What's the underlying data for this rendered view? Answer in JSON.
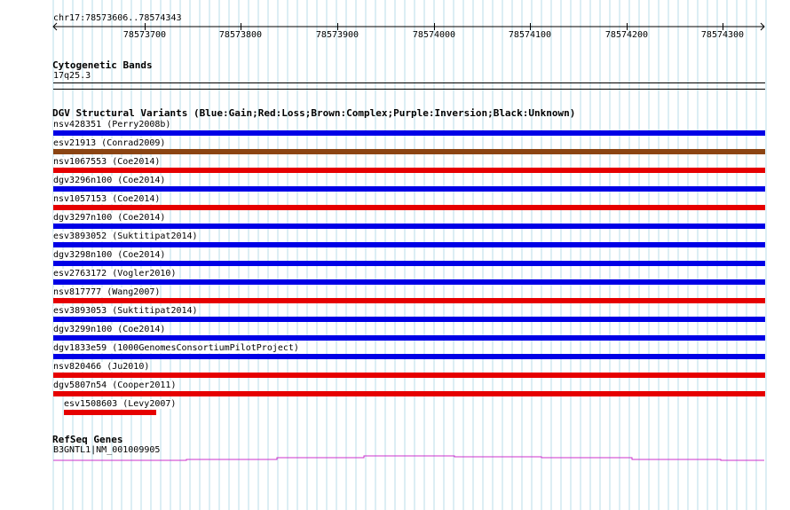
{
  "region": "chr17:78573606..78574343",
  "ruler": {
    "ticks": [
      "78573700",
      "78573800",
      "78573900",
      "78574000",
      "78574100",
      "78574200",
      "78574300"
    ]
  },
  "cytoband": {
    "title": "Cytogenetic Bands",
    "band": "17q25.3"
  },
  "dgv": {
    "title": "DGV Structural Variants (Blue:Gain;Red:Loss;Brown:Complex;Purple:Inversion;Black:Unknown)",
    "colors": {
      "gain": "#0000e6",
      "loss": "#e60000",
      "complex": "#8b4513"
    },
    "variants": [
      {
        "label": "nsv428351 (Perry2008b)",
        "type": "gain"
      },
      {
        "label": "esv21913 (Conrad2009)",
        "type": "complex"
      },
      {
        "label": "nsv1067553 (Coe2014)",
        "type": "loss"
      },
      {
        "label": "dgv3296n100 (Coe2014)",
        "type": "gain"
      },
      {
        "label": "nsv1057153 (Coe2014)",
        "type": "loss"
      },
      {
        "label": "dgv3297n100 (Coe2014)",
        "type": "gain"
      },
      {
        "label": "esv3893052 (Suktitipat2014)",
        "type": "gain"
      },
      {
        "label": "dgv3298n100 (Coe2014)",
        "type": "gain"
      },
      {
        "label": "esv2763172 (Vogler2010)",
        "type": "gain"
      },
      {
        "label": "nsv817777 (Wang2007)",
        "type": "loss"
      },
      {
        "label": "esv3893053 (Suktitipat2014)",
        "type": "gain"
      },
      {
        "label": "dgv3299n100 (Coe2014)",
        "type": "gain"
      },
      {
        "label": "dgv1833e59 (1000GenomesConsortiumPilotProject)",
        "type": "gain"
      },
      {
        "label": "nsv820466 (Ju2010)",
        "type": "loss"
      },
      {
        "label": "dgv5807n54 (Cooper2011)",
        "type": "loss"
      },
      {
        "label": "esv1508603 (Levy2007)",
        "type": "loss"
      }
    ]
  },
  "refseq": {
    "title": "RefSeq Genes",
    "gene": "B3GNTL1|NM_001009905",
    "color": "#cc33cc"
  }
}
